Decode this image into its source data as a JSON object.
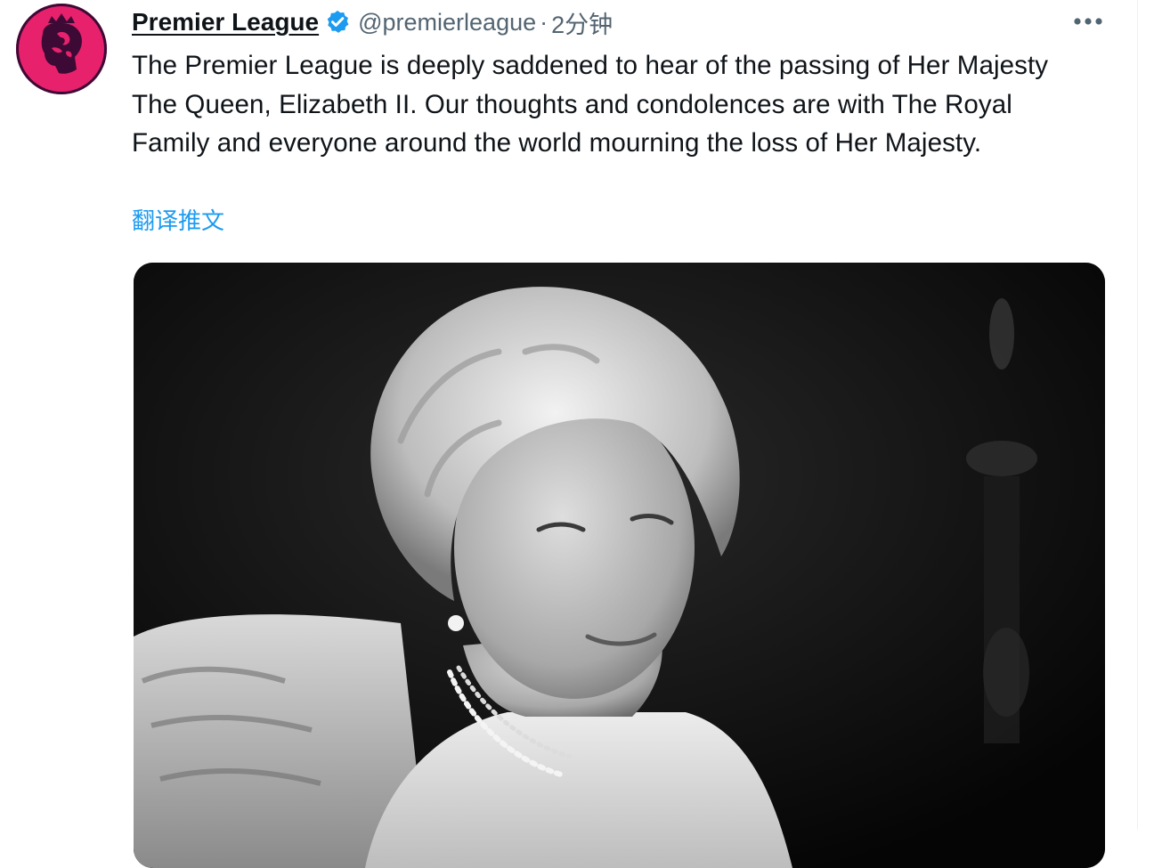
{
  "tweet": {
    "display_name": "Premier League",
    "handle": "@premierleague",
    "separator": "·",
    "time_ago": "2分钟",
    "text": "The Premier League is deeply saddened to hear of the passing of Her Majesty The Queen, Elizabeth II. Our thoughts and condolences are with The Royal Family and everyone around the world mourning the loss of Her Majesty.",
    "translate_label": "翻译推文"
  },
  "icons": {
    "avatar": "premier-league-lion-logo",
    "verified": "verified-badge-icon",
    "more": "more-horizontal-icon"
  },
  "colors": {
    "brand_magenta": "#e8216d",
    "brand_purple": "#3d0a35",
    "link_blue": "#1d9bf0",
    "secondary_text": "#536471"
  }
}
